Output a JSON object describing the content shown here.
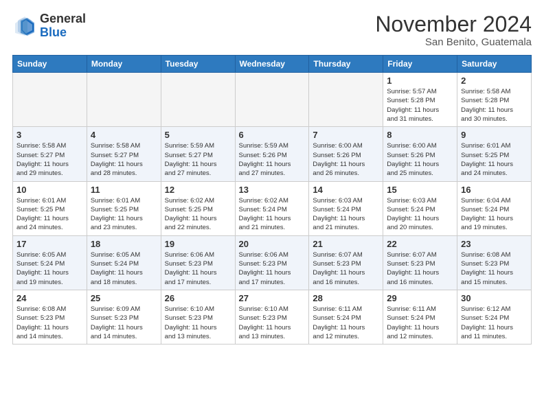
{
  "header": {
    "logo_general": "General",
    "logo_blue": "Blue",
    "month": "November 2024",
    "location": "San Benito, Guatemala"
  },
  "weekdays": [
    "Sunday",
    "Monday",
    "Tuesday",
    "Wednesday",
    "Thursday",
    "Friday",
    "Saturday"
  ],
  "weeks": [
    [
      {
        "day": "",
        "info": ""
      },
      {
        "day": "",
        "info": ""
      },
      {
        "day": "",
        "info": ""
      },
      {
        "day": "",
        "info": ""
      },
      {
        "day": "",
        "info": ""
      },
      {
        "day": "1",
        "info": "Sunrise: 5:57 AM\nSunset: 5:28 PM\nDaylight: 11 hours\nand 31 minutes."
      },
      {
        "day": "2",
        "info": "Sunrise: 5:58 AM\nSunset: 5:28 PM\nDaylight: 11 hours\nand 30 minutes."
      }
    ],
    [
      {
        "day": "3",
        "info": "Sunrise: 5:58 AM\nSunset: 5:27 PM\nDaylight: 11 hours\nand 29 minutes."
      },
      {
        "day": "4",
        "info": "Sunrise: 5:58 AM\nSunset: 5:27 PM\nDaylight: 11 hours\nand 28 minutes."
      },
      {
        "day": "5",
        "info": "Sunrise: 5:59 AM\nSunset: 5:27 PM\nDaylight: 11 hours\nand 27 minutes."
      },
      {
        "day": "6",
        "info": "Sunrise: 5:59 AM\nSunset: 5:26 PM\nDaylight: 11 hours\nand 27 minutes."
      },
      {
        "day": "7",
        "info": "Sunrise: 6:00 AM\nSunset: 5:26 PM\nDaylight: 11 hours\nand 26 minutes."
      },
      {
        "day": "8",
        "info": "Sunrise: 6:00 AM\nSunset: 5:26 PM\nDaylight: 11 hours\nand 25 minutes."
      },
      {
        "day": "9",
        "info": "Sunrise: 6:01 AM\nSunset: 5:25 PM\nDaylight: 11 hours\nand 24 minutes."
      }
    ],
    [
      {
        "day": "10",
        "info": "Sunrise: 6:01 AM\nSunset: 5:25 PM\nDaylight: 11 hours\nand 24 minutes."
      },
      {
        "day": "11",
        "info": "Sunrise: 6:01 AM\nSunset: 5:25 PM\nDaylight: 11 hours\nand 23 minutes."
      },
      {
        "day": "12",
        "info": "Sunrise: 6:02 AM\nSunset: 5:25 PM\nDaylight: 11 hours\nand 22 minutes."
      },
      {
        "day": "13",
        "info": "Sunrise: 6:02 AM\nSunset: 5:24 PM\nDaylight: 11 hours\nand 21 minutes."
      },
      {
        "day": "14",
        "info": "Sunrise: 6:03 AM\nSunset: 5:24 PM\nDaylight: 11 hours\nand 21 minutes."
      },
      {
        "day": "15",
        "info": "Sunrise: 6:03 AM\nSunset: 5:24 PM\nDaylight: 11 hours\nand 20 minutes."
      },
      {
        "day": "16",
        "info": "Sunrise: 6:04 AM\nSunset: 5:24 PM\nDaylight: 11 hours\nand 19 minutes."
      }
    ],
    [
      {
        "day": "17",
        "info": "Sunrise: 6:05 AM\nSunset: 5:24 PM\nDaylight: 11 hours\nand 19 minutes."
      },
      {
        "day": "18",
        "info": "Sunrise: 6:05 AM\nSunset: 5:24 PM\nDaylight: 11 hours\nand 18 minutes."
      },
      {
        "day": "19",
        "info": "Sunrise: 6:06 AM\nSunset: 5:23 PM\nDaylight: 11 hours\nand 17 minutes."
      },
      {
        "day": "20",
        "info": "Sunrise: 6:06 AM\nSunset: 5:23 PM\nDaylight: 11 hours\nand 17 minutes."
      },
      {
        "day": "21",
        "info": "Sunrise: 6:07 AM\nSunset: 5:23 PM\nDaylight: 11 hours\nand 16 minutes."
      },
      {
        "day": "22",
        "info": "Sunrise: 6:07 AM\nSunset: 5:23 PM\nDaylight: 11 hours\nand 16 minutes."
      },
      {
        "day": "23",
        "info": "Sunrise: 6:08 AM\nSunset: 5:23 PM\nDaylight: 11 hours\nand 15 minutes."
      }
    ],
    [
      {
        "day": "24",
        "info": "Sunrise: 6:08 AM\nSunset: 5:23 PM\nDaylight: 11 hours\nand 14 minutes."
      },
      {
        "day": "25",
        "info": "Sunrise: 6:09 AM\nSunset: 5:23 PM\nDaylight: 11 hours\nand 14 minutes."
      },
      {
        "day": "26",
        "info": "Sunrise: 6:10 AM\nSunset: 5:23 PM\nDaylight: 11 hours\nand 13 minutes."
      },
      {
        "day": "27",
        "info": "Sunrise: 6:10 AM\nSunset: 5:23 PM\nDaylight: 11 hours\nand 13 minutes."
      },
      {
        "day": "28",
        "info": "Sunrise: 6:11 AM\nSunset: 5:24 PM\nDaylight: 11 hours\nand 12 minutes."
      },
      {
        "day": "29",
        "info": "Sunrise: 6:11 AM\nSunset: 5:24 PM\nDaylight: 11 hours\nand 12 minutes."
      },
      {
        "day": "30",
        "info": "Sunrise: 6:12 AM\nSunset: 5:24 PM\nDaylight: 11 hours\nand 11 minutes."
      }
    ]
  ]
}
